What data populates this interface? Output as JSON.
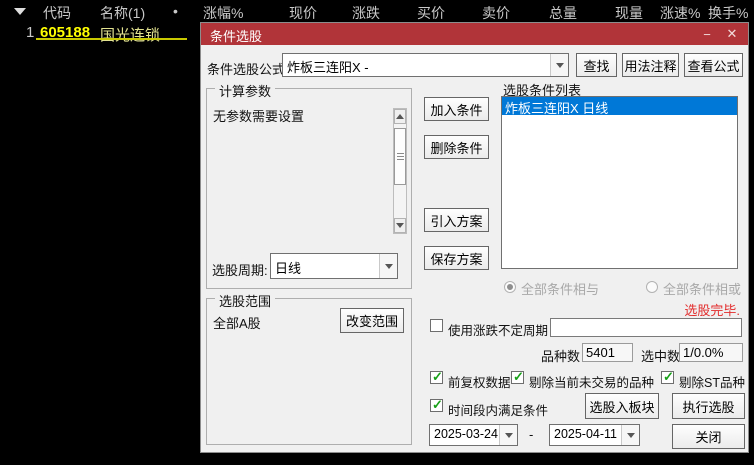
{
  "colors": {
    "title_bar_red": "#b13439",
    "selection_blue": "#0078d7",
    "check_green": "#18a018",
    "status_red": "#e22b2b",
    "code_yellow": "#ffff00",
    "name_yellow": "#e3e390"
  },
  "table": {
    "headers": {
      "code": "代码",
      "name": "名称(1)",
      "bullet": "•",
      "change_pct": "涨幅%",
      "price": "现价",
      "change": "涨跌",
      "buy": "买价",
      "sell": "卖价",
      "total_vol": "总量",
      "cur_vol": "现量",
      "speed": "涨速%",
      "turnover": "换手%"
    },
    "row": {
      "index": "1",
      "code": "605188",
      "name": "国光连锁"
    }
  },
  "dialog": {
    "title": "条件选股",
    "minimize_icon": "−",
    "close_icon": "✕",
    "formula_label": "条件选股公式",
    "formula_value": "炸板三连阳X -",
    "btn_find": "查找",
    "btn_usage": "用法注释",
    "btn_view_formula": "查看公式",
    "params_group": "计算参数",
    "params_empty": "无参数需要设置",
    "period_label": "选股周期:",
    "period_value": "日线",
    "btn_add": "加入条件",
    "btn_delete": "删除条件",
    "btn_import": "引入方案",
    "btn_save": "保存方案",
    "list_label": "选股条件列表",
    "list_item": "炸板三连阳X  日线",
    "list_item_selected": true,
    "radio_and": "全部条件相与",
    "radio_and_selected": true,
    "radio_or": "全部条件相或",
    "radio_or_selected": false,
    "range_group": "选股范围",
    "range_value": "全部A股",
    "btn_change_range": "改变范围",
    "status_text": "选股完毕.",
    "chk_updown": {
      "label": "使用涨跌不定周期",
      "checked": false
    },
    "updown_input_value": "",
    "variety_label": "品种数",
    "variety_value": "5401",
    "selected_label": "选中数",
    "selected_value": "1/0.0%",
    "chk_fuquan": {
      "label": "前复权数据",
      "checked": true
    },
    "chk_no_trade": {
      "label": "剔除当前未交易的品种",
      "checked": true
    },
    "chk_st": {
      "label": "剔除ST品种",
      "checked": true
    },
    "chk_timerange": {
      "label": "时间段内满足条件",
      "checked": true
    },
    "btn_to_block": "选股入板块",
    "btn_execute": "执行选股",
    "date_from": "2025-03-24",
    "date_sep": "-",
    "date_to": "2025-04-11",
    "btn_close": "关闭"
  }
}
